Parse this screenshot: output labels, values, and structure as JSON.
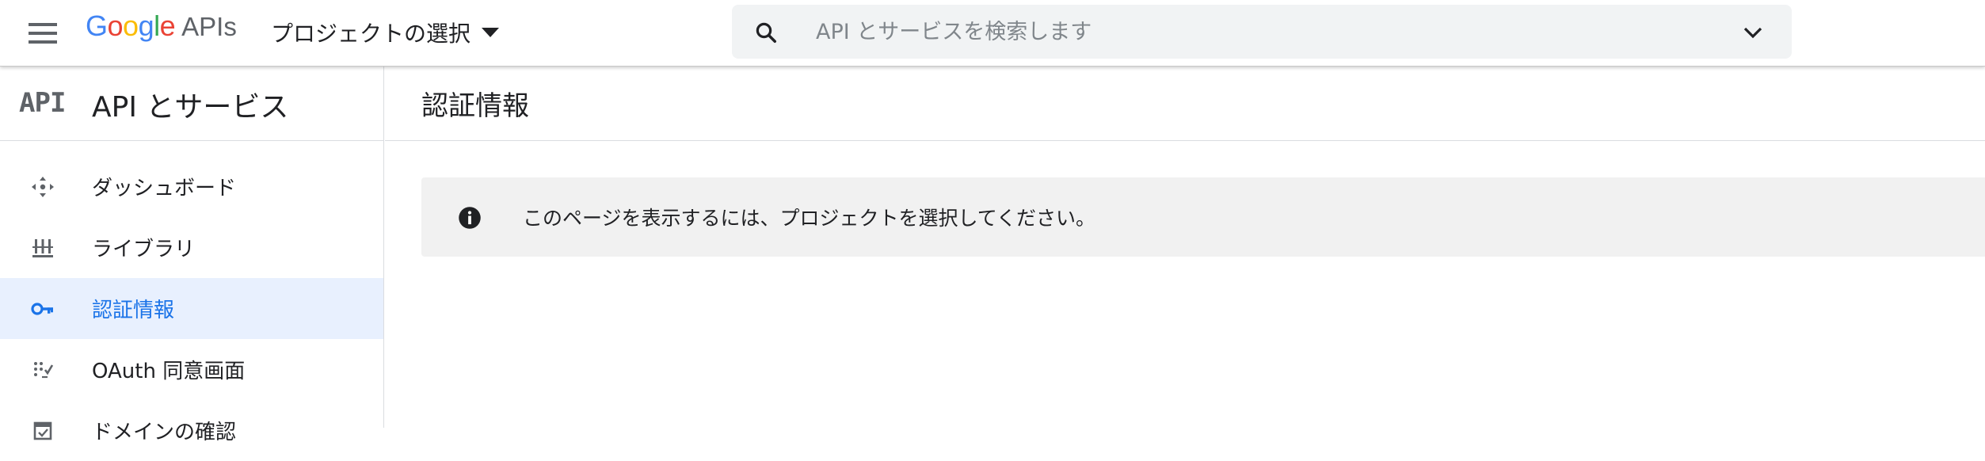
{
  "header": {
    "menu_icon": "hamburger-menu-icon",
    "logo_google": "Google",
    "logo_apis": "APIs",
    "project_picker_label": "プロジェクトの選択",
    "search_placeholder": "API とサービスを検索します",
    "search_value": ""
  },
  "sidebar": {
    "icon_text": "API",
    "title": "API とサービス",
    "items": [
      {
        "label": "ダッシュボード",
        "icon": "dashboard-icon",
        "active": false
      },
      {
        "label": "ライブラリ",
        "icon": "library-icon",
        "active": false
      },
      {
        "label": "認証情報",
        "icon": "key-icon",
        "active": true
      },
      {
        "label": "OAuth 同意画面",
        "icon": "oauth-consent-icon",
        "active": false
      },
      {
        "label": "ドメインの確認",
        "icon": "domain-verification-icon",
        "active": false
      }
    ]
  },
  "main": {
    "page_title": "認証情報",
    "notice": "このページを表示するには、プロジェクトを選択してください。"
  },
  "colors": {
    "accent": "#1a73e8",
    "active_bg": "#e8f0fe",
    "notice_bg": "#f1f1f1",
    "search_bg": "#f1f3f4"
  }
}
